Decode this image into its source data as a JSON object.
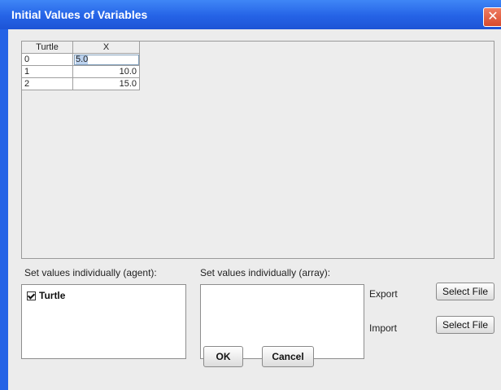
{
  "window": {
    "title": "Initial Values of Variables",
    "close_glyph": "✕"
  },
  "table": {
    "columns": [
      "Turtle",
      "X"
    ],
    "rows": [
      {
        "turtle": "0",
        "x": "5.0"
      },
      {
        "turtle": "1",
        "x": "10.0"
      },
      {
        "turtle": "2",
        "x": "15.0"
      }
    ]
  },
  "agent_section": {
    "label": "Set values individually (agent):",
    "items": [
      {
        "label": "Turtle",
        "checked": true
      }
    ]
  },
  "array_section": {
    "label": "Set values individually (array):"
  },
  "export": {
    "label": "Export",
    "button": "Select File"
  },
  "import": {
    "label": "Import",
    "button": "Select File"
  },
  "footer": {
    "ok": "OK",
    "cancel": "Cancel"
  },
  "colors": {
    "titlebar": "#2563e6",
    "close": "#d74a2c"
  }
}
